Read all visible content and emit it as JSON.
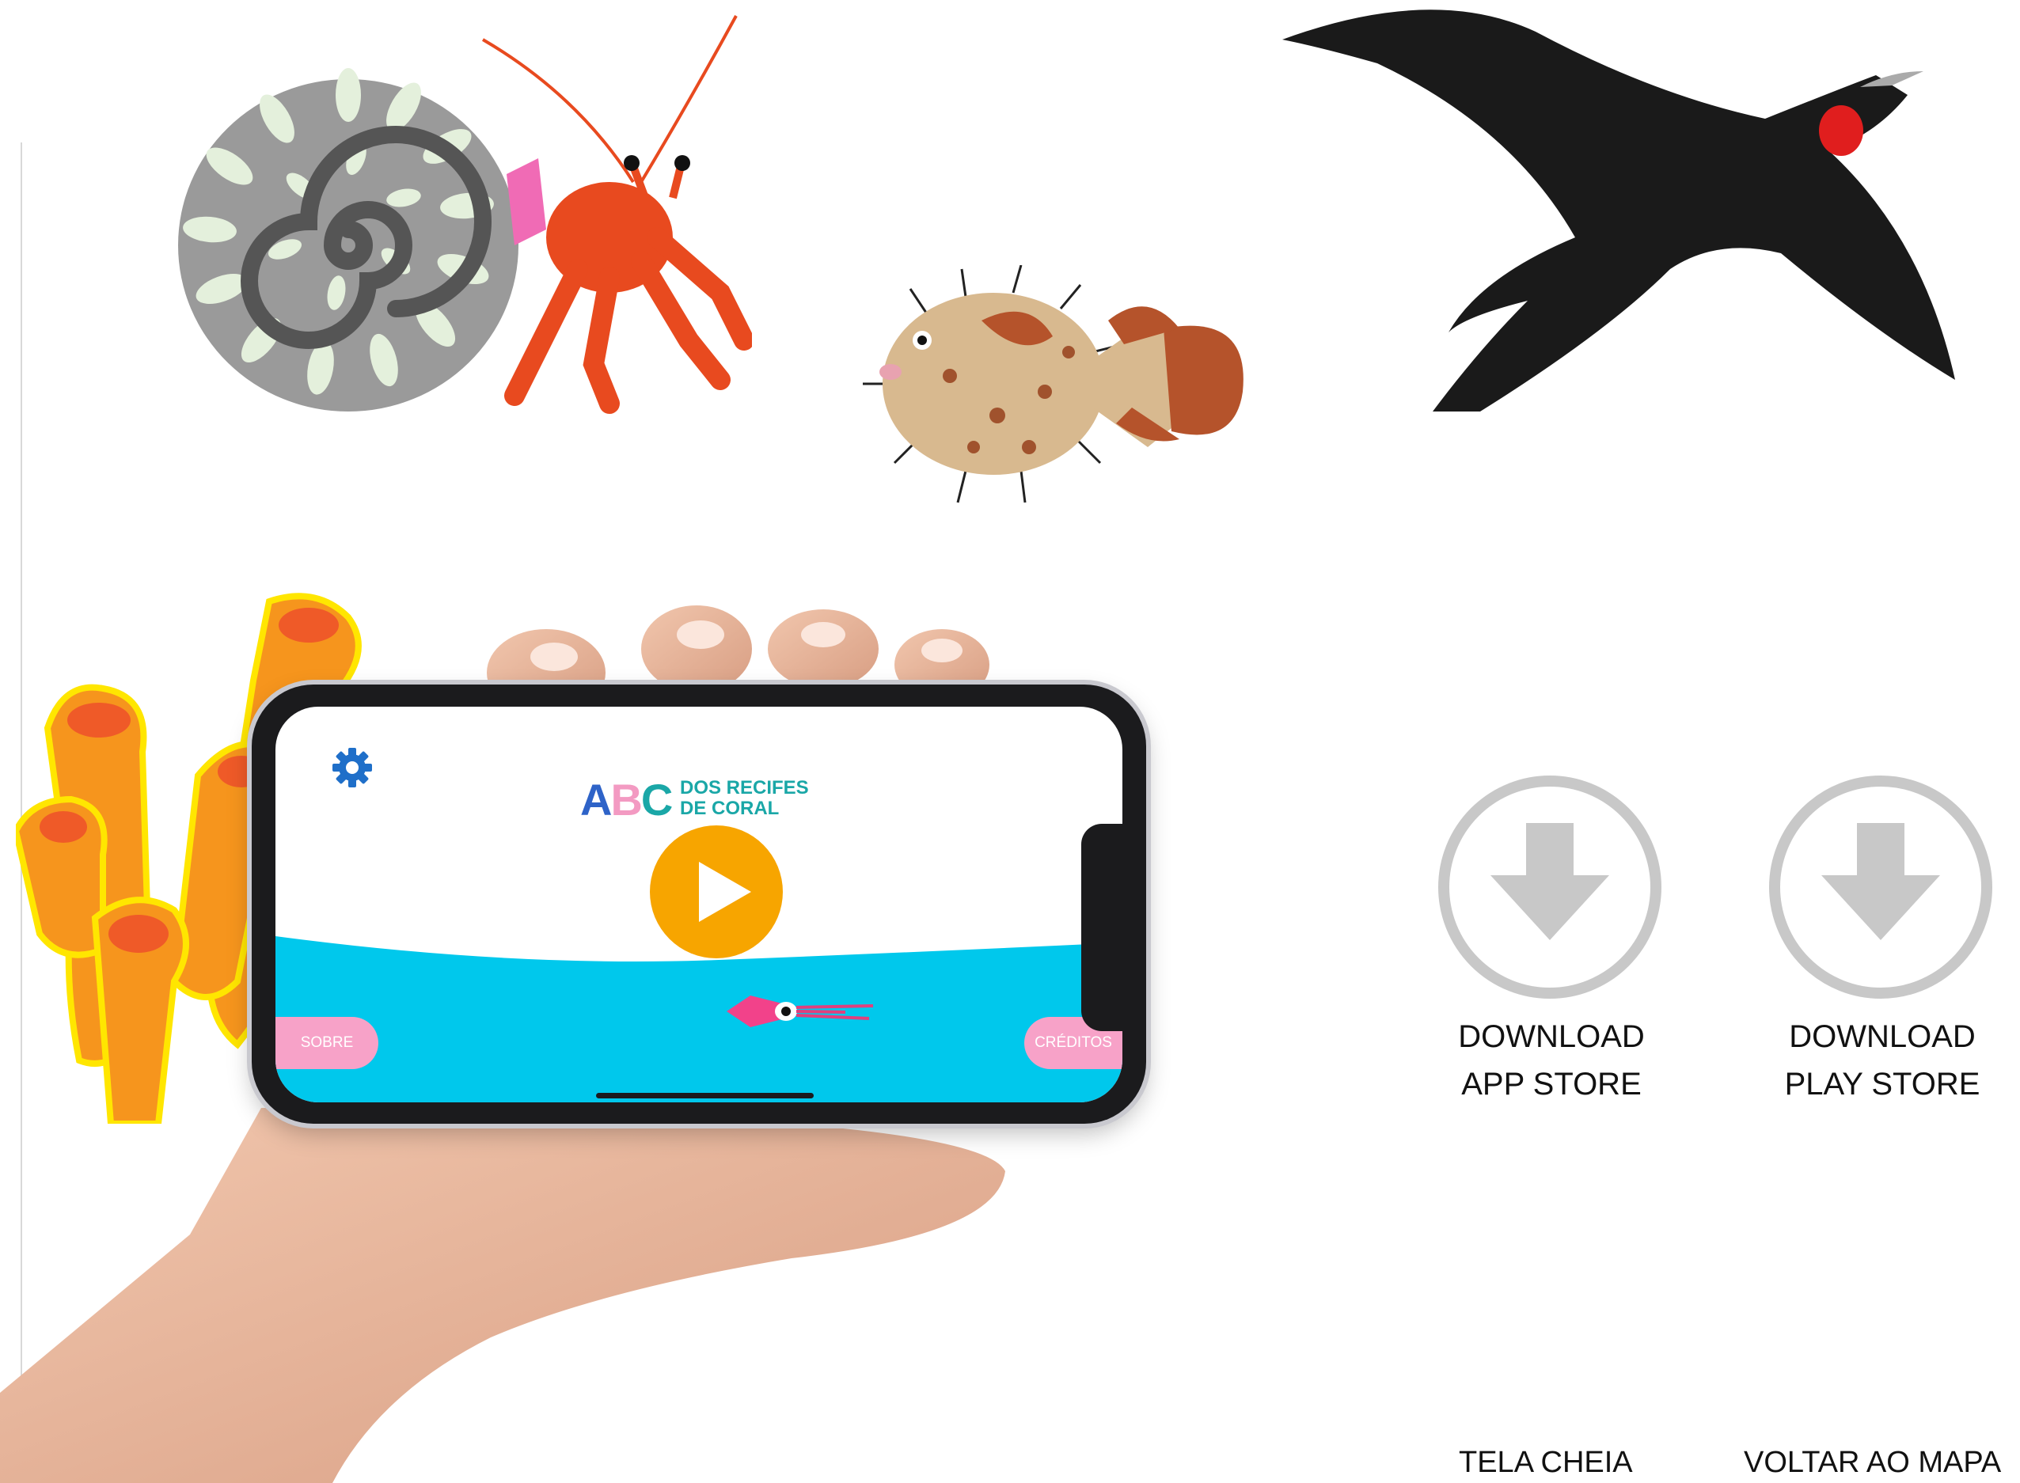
{
  "app": {
    "logo_letters": [
      "A",
      "B",
      "C"
    ],
    "logo_tagline_line1": "DOS RECIFES",
    "logo_tagline_line2": "DE CORAL",
    "about_label": "SOBRE",
    "credits_label": "CRÉDITOS",
    "play_icon": "play-icon",
    "settings_icon": "gear-icon"
  },
  "downloads": [
    {
      "line1": "DOWNLOAD",
      "line2": "APP STORE",
      "icon": "download-arrow-icon"
    },
    {
      "line1": "DOWNLOAD",
      "line2": "PLAY STORE",
      "icon": "download-arrow-icon"
    }
  ],
  "bottom_nav": {
    "fullscreen_label": "TELA CHEIA",
    "back_to_map_label": "VOLTAR AO MAPA"
  },
  "colors": {
    "play_button": "#f7a500",
    "sea": "#00c8ec",
    "pill_buttons": "#f7a2c8",
    "settings_icon": "#1f6fc9",
    "download_icon": "#c8c8c8",
    "logo_teal": "#1aa7a7"
  }
}
